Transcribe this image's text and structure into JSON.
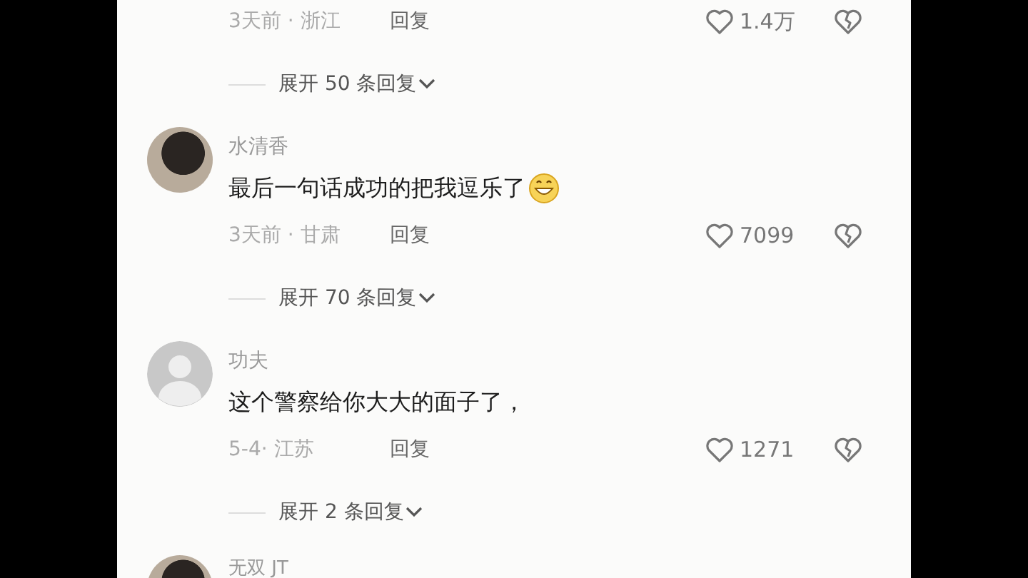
{
  "comments": [
    {
      "meta": "3天前 · 浙江",
      "reply_label": "回复",
      "likes": "1.4万",
      "expand_label": "展开 50 条回复"
    },
    {
      "kind": "photo",
      "name": "水清香",
      "text": "最后一句话成功的把我逗乐了",
      "has_emoji": true,
      "meta": "3天前 · 甘肃",
      "reply_label": "回复",
      "likes": "7099",
      "expand_label": "展开 70 条回复"
    },
    {
      "kind": "default",
      "name": "功夫",
      "text": "这个警察给你大大的面子了，",
      "has_emoji": false,
      "meta": "5-4· 江苏",
      "reply_label": "回复",
      "likes": "1271",
      "expand_label": "展开 2 条回复"
    },
    {
      "kind": "photo",
      "name": "无双 JT"
    }
  ]
}
